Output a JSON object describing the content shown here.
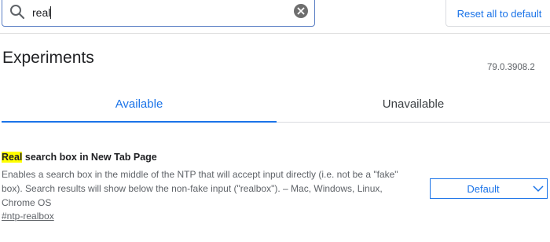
{
  "search": {
    "value": "real",
    "icon": "search-icon",
    "clear_icon": "clear-icon"
  },
  "header": {
    "reset_label": "Reset all to default"
  },
  "page": {
    "title": "Experiments",
    "version": "79.0.3908.2"
  },
  "tabs": [
    {
      "label": "Available",
      "selected": true
    },
    {
      "label": "Unavailable",
      "selected": false
    }
  ],
  "experiment": {
    "title_highlight": "Real",
    "title_rest": " search box in New Tab Page",
    "description": "Enables a search box in the middle of the NTP that will accept input directly (i.e. not be a \"fake\" box). Search results will show below the non-fake input (\"realbox\"). – Mac, Windows, Linux, Chrome OS",
    "link": "#ntp-realbox",
    "select_value": "Default"
  },
  "colors": {
    "accent": "#1a73e8",
    "highlight": "#ffff00",
    "text_secondary": "#5f6368"
  }
}
